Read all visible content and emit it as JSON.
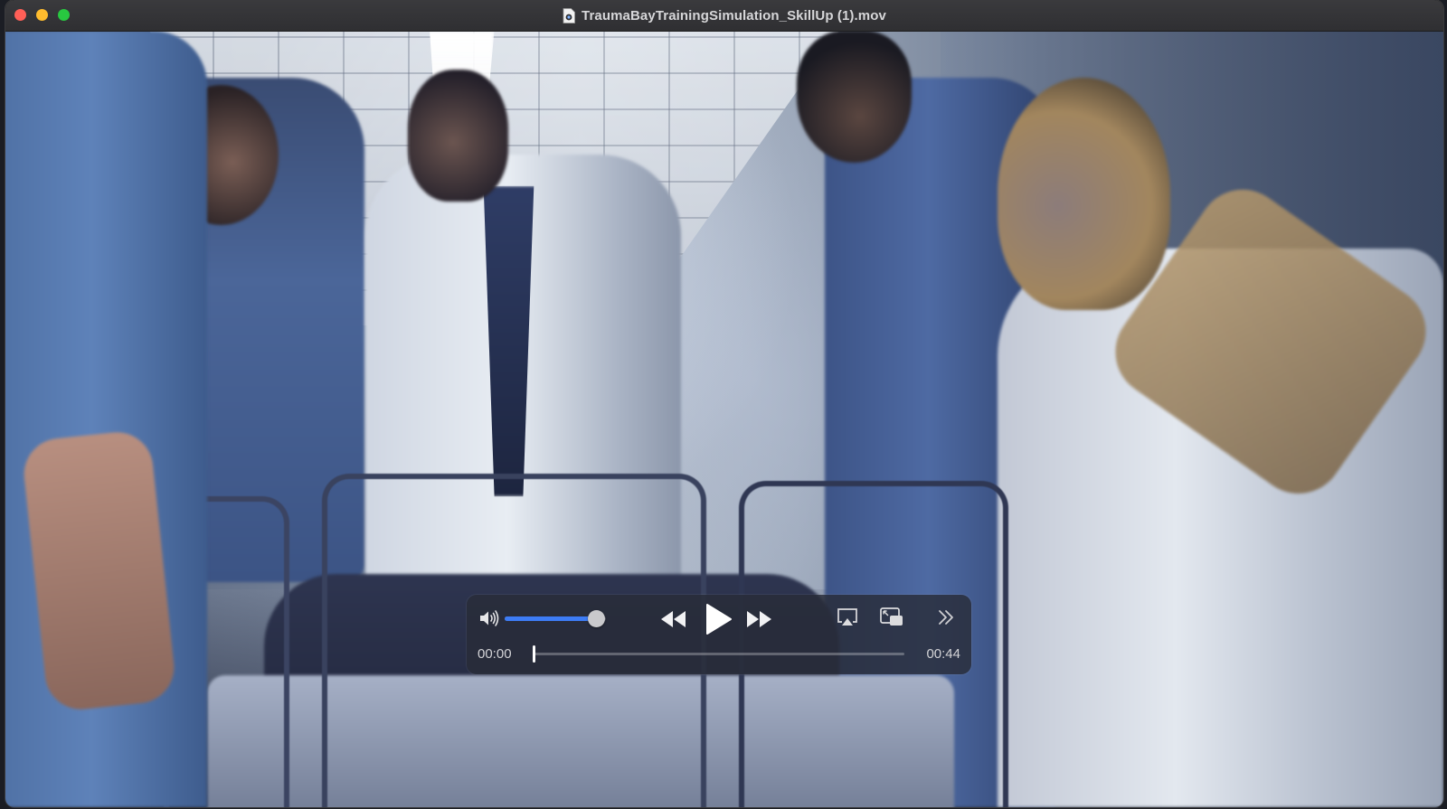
{
  "window": {
    "title": "TraumaBayTrainingSimulation_SkillUp (1).mov",
    "title_icon": "quicktime-document-icon"
  },
  "video": {
    "content": "hospital-corridor-gurney-scene"
  },
  "controls": {
    "volume_icon": "speaker-icon",
    "volume_level": 0.9,
    "rewind_icon": "rewind-icon",
    "play_icon": "play-icon",
    "forward_icon": "fast-forward-icon",
    "airplay_icon": "airplay-icon",
    "pip_icon": "picture-in-picture-icon",
    "more_icon": "chevron-double-right-icon",
    "current_time": "00:00",
    "total_time": "00:44",
    "progress": 0.0
  },
  "colors": {
    "accent": "#3d7cf5",
    "close": "#ff5f57",
    "minimize": "#febc2e",
    "maximize": "#28c840"
  }
}
